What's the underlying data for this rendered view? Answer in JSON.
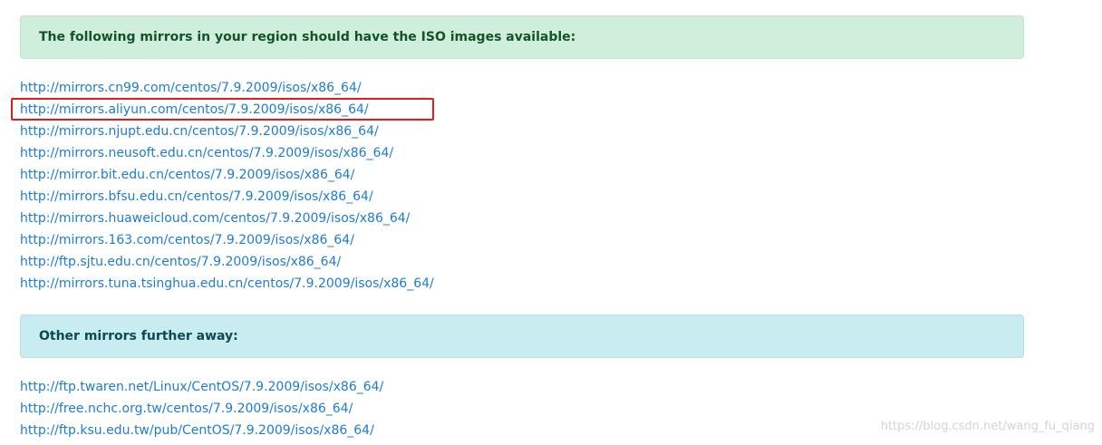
{
  "regional_alert": {
    "text": "The following mirrors in your region should have the ISO images available:"
  },
  "regional_mirrors": [
    "http://mirrors.cn99.com/centos/7.9.2009/isos/x86_64/",
    "http://mirrors.aliyun.com/centos/7.9.2009/isos/x86_64/",
    "http://mirrors.njupt.edu.cn/centos/7.9.2009/isos/x86_64/",
    "http://mirrors.neusoft.edu.cn/centos/7.9.2009/isos/x86_64/",
    "http://mirror.bit.edu.cn/centos/7.9.2009/isos/x86_64/",
    "http://mirrors.bfsu.edu.cn/centos/7.9.2009/isos/x86_64/",
    "http://mirrors.huaweicloud.com/centos/7.9.2009/isos/x86_64/",
    "http://mirrors.163.com/centos/7.9.2009/isos/x86_64/",
    "http://ftp.sjtu.edu.cn/centos/7.9.2009/isos/x86_64/",
    "http://mirrors.tuna.tsinghua.edu.cn/centos/7.9.2009/isos/x86_64/"
  ],
  "other_alert": {
    "text": "Other mirrors further away:"
  },
  "other_mirrors": [
    "http://ftp.twaren.net/Linux/CentOS/7.9.2009/isos/x86_64/",
    "http://free.nchc.org.tw/centos/7.9.2009/isos/x86_64/",
    "http://ftp.ksu.edu.tw/pub/CentOS/7.9.2009/isos/x86_64/"
  ],
  "watermark": "https://blog.csdn.net/wang_fu_qiang",
  "colors": {
    "link": "#1c7cd6",
    "success_bg": "#d0eedc",
    "info_bg": "#c9ecf0",
    "highlight": "#e21c1c"
  }
}
